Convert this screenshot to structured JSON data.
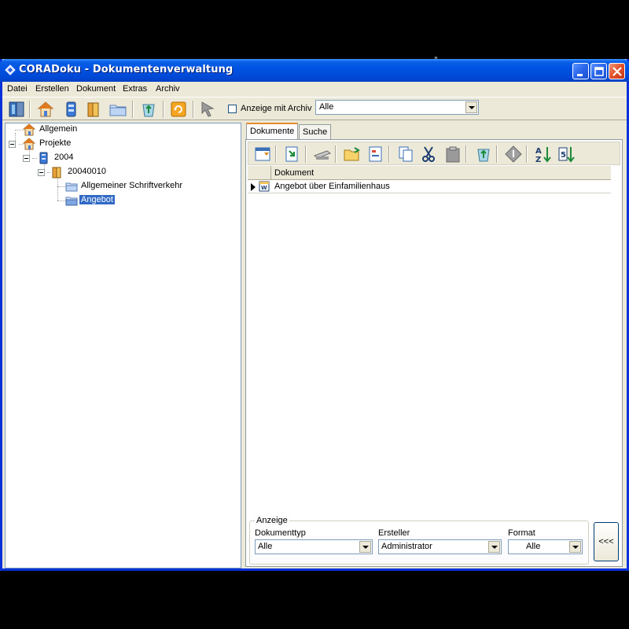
{
  "window": {
    "title": "CORADoku - Dokumentenverwaltung"
  },
  "menu": {
    "items": [
      "Datei",
      "Erstellen",
      "Dokument",
      "Extras",
      "Archiv"
    ]
  },
  "toolbar": {
    "icons": [
      "exit-icon",
      "home-icon",
      "database-icon",
      "books-icon",
      "folder-icon",
      "recycle-icon",
      "refresh-icon",
      "cursor-icon"
    ],
    "archive_checkbox_label": "Anzeige mit Archiv",
    "archive_checked": false,
    "archive_select_value": "Alle"
  },
  "tree": {
    "nodes": [
      {
        "label": "Allgemein",
        "icon": "house-icon"
      },
      {
        "label": "Projekte",
        "icon": "house-icon",
        "expanded": true
      },
      {
        "label": "2004",
        "icon": "book-icon",
        "expanded": true
      },
      {
        "label": "20040010",
        "icon": "folder-orange-icon",
        "expanded": true
      },
      {
        "label": "Allgemeiner Schriftverkehr",
        "icon": "folder-blue-icon"
      },
      {
        "label": "Angebot",
        "icon": "folder-blue-icon",
        "selected": true
      }
    ]
  },
  "tabs": [
    {
      "label": "Dokumente",
      "active": true
    },
    {
      "label": "Suche",
      "active": false
    }
  ],
  "doc_toolbar": {
    "icons": [
      "new-document-icon",
      "import-icon",
      "scanner-icon",
      "open-folder-icon",
      "properties-icon",
      "copy-icon",
      "cut-icon",
      "paste-icon",
      "recycle-icon",
      "info-icon",
      "sort-alpha-icon",
      "sort-numeric-icon"
    ]
  },
  "doc_table": {
    "header": "Dokument",
    "rows": [
      {
        "label": "Angebot über Einfamilienhaus",
        "icon": "word-document-icon",
        "current": true
      }
    ]
  },
  "filter": {
    "legend": "Anzeige",
    "doctype_label": "Dokumenttyp",
    "doctype_value": "Alle",
    "creator_label": "Ersteller",
    "creator_value": "Administrator",
    "format_label": "Format",
    "format_value": "Alle",
    "collapse_label": "<<<"
  },
  "colors": {
    "titlebar": "#0054e3",
    "selection": "#316ac5",
    "window_face": "#ece9d8"
  }
}
